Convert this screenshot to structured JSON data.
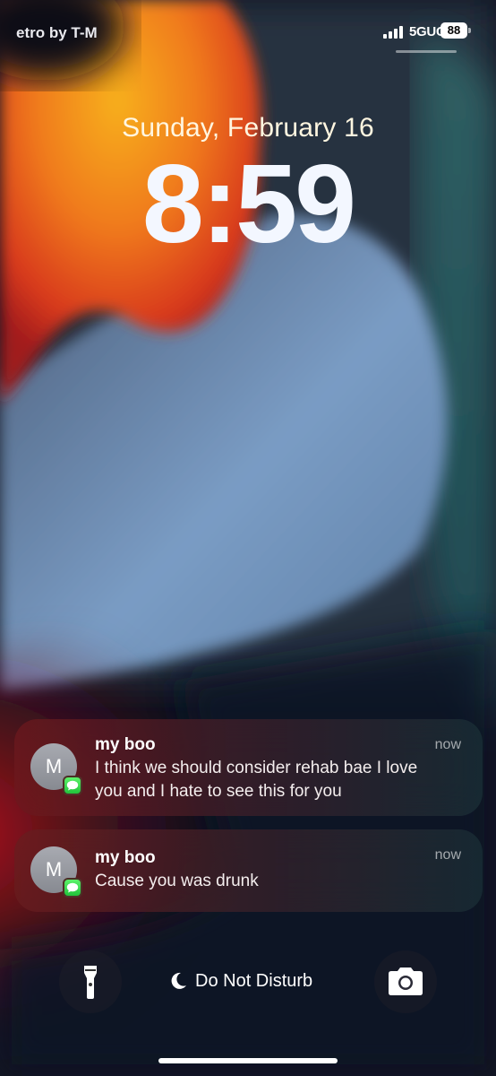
{
  "status_bar": {
    "carrier": "etro by T-M",
    "network": "5GUC",
    "battery": "88"
  },
  "lock_screen": {
    "date": "Sunday, February 16",
    "time": "8:59"
  },
  "notifications": [
    {
      "avatar_initial": "M",
      "sender": "my boo",
      "message": "I think we should consider rehab bae I love you and I hate to see this for you",
      "timestamp": "now",
      "app_icon": "messages-icon"
    },
    {
      "avatar_initial": "M",
      "sender": "my boo",
      "message": "Cause you was drunk",
      "timestamp": "now",
      "app_icon": "messages-icon"
    }
  ],
  "quick_actions": {
    "left_icon": "flashlight-icon",
    "right_icon": "camera-icon",
    "focus_label": "Do Not Disturb",
    "focus_icon": "moon-icon"
  },
  "colors": {
    "messages_green": "#34c759",
    "date_tint": "#fff6e0"
  }
}
